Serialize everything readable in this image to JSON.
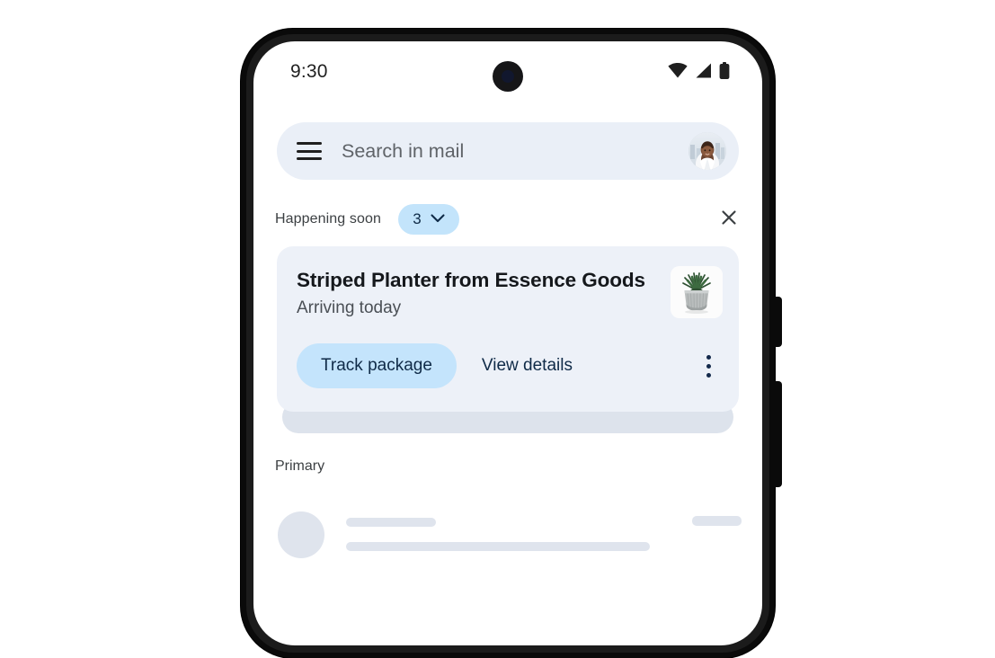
{
  "device": {
    "name": "android-phone",
    "side_buttons": [
      "volume-rocker",
      "power-button"
    ]
  },
  "status_bar": {
    "time": "9:30",
    "icons": [
      "wifi-icon",
      "cellular-signal-icon",
      "battery-icon"
    ]
  },
  "search": {
    "menu_icon": "hamburger-menu-icon",
    "placeholder": "Search in mail",
    "value": "",
    "avatar": "user-avatar"
  },
  "happening_soon": {
    "label": "Happening soon",
    "count": "3",
    "expand_icon": "chevron-down-icon",
    "dismiss_icon": "close-icon",
    "chip_color": "#c3e4fb"
  },
  "package_card": {
    "title": "Striped Planter from Essence Goods",
    "subtitle": "Arriving today",
    "thumbnail": "potted-plant-image",
    "primary_action": "Track package",
    "secondary_action": "View details",
    "overflow_icon": "more-vertical-icon",
    "card_color": "#edf1f8",
    "primary_action_color": "#c4e4fc"
  },
  "inbox": {
    "section_label": "Primary",
    "placeholder_rows": 1
  }
}
